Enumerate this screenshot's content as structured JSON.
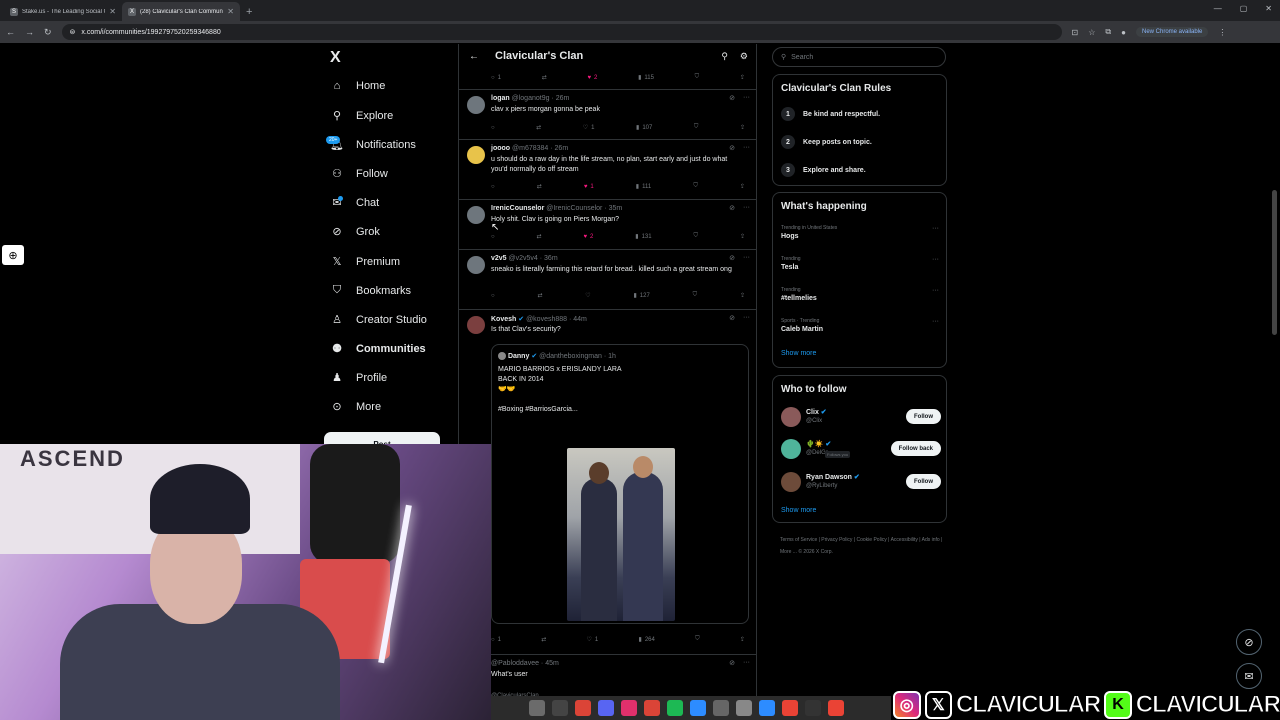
{
  "browser": {
    "tabs": [
      {
        "label": "Stake.us - The Leading Social C",
        "icon": "stake-favicon"
      },
      {
        "label": "(28) Clavicular's Clan Communi",
        "icon": "x-favicon"
      }
    ],
    "url": "x.com/i/communities/1992797520259346880",
    "update_label": "New Chrome available"
  },
  "nav": {
    "logo": "X",
    "items": [
      {
        "label": "Home",
        "icon": "home-icon"
      },
      {
        "label": "Explore",
        "icon": "search-icon"
      },
      {
        "label": "Notifications",
        "icon": "bell-icon"
      },
      {
        "label": "Follow",
        "icon": "follow-icon"
      },
      {
        "label": "Chat",
        "icon": "chat-icon"
      },
      {
        "label": "Grok",
        "icon": "grok-icon"
      },
      {
        "label": "Premium",
        "icon": "x-icon"
      },
      {
        "label": "Bookmarks",
        "icon": "bookmark-icon"
      },
      {
        "label": "Creator Studio",
        "icon": "creator-icon"
      },
      {
        "label": "Communities",
        "icon": "communities-icon"
      },
      {
        "label": "Profile",
        "icon": "profile-icon"
      },
      {
        "label": "More",
        "icon": "more-icon"
      }
    ],
    "notif_badge": "20+",
    "post_label": "Post"
  },
  "feed": {
    "title": "Clavicular's Clan",
    "top_actions": {
      "replies": "1",
      "likes": "2",
      "views": "115"
    },
    "tweets": [
      {
        "name": "logan",
        "handle": "@loganot9g · 26m",
        "text": "clav x piers morgan gonna be peak",
        "replies": "",
        "likes": "1",
        "views": "107",
        "liked": false
      },
      {
        "name": "joooo",
        "handle": "@m678384 · 26m",
        "text": "u should do a raw day in the life stream, no plan, start early and just do what you'd normally do off stream",
        "replies": "",
        "likes": "1",
        "views": "111",
        "liked": true
      },
      {
        "name": "IrenicCounselor",
        "handle": "@IrenicCounselor · 35m",
        "text": "Holy shit. Clav is going on Piers Morgan?",
        "replies": "",
        "likes": "2",
        "views": "131",
        "liked": true
      },
      {
        "name": "v2v5",
        "handle": "@v2v5v4 · 36m",
        "text": "sneako is literally farming this retard for bread.. killed such a great stream ong",
        "replies": "",
        "likes": "",
        "views": "127",
        "liked": false
      },
      {
        "name": "Kovesh",
        "handle": "@kovesh888 · 44m",
        "text": "Is that Clav's security?",
        "replies": "1",
        "likes": "1",
        "views": "264",
        "liked": false
      }
    ],
    "quote": {
      "name": "Danny",
      "handle": "@dantheboxingman · 1h",
      "lines": [
        "MARIO BARRIOS x ERISLANDY LARA",
        "BACK IN 2014",
        "🤝🤝",
        "",
        "#Boxing #BarriosGarcia..."
      ]
    },
    "last_tweet": {
      "handle": "@Pabloddavee · 45m",
      "text": "What's user",
      "sub": "@ClavicularsClan"
    }
  },
  "sidebar": {
    "search_placeholder": "Search",
    "rules_title": "Clavicular's Clan Rules",
    "rules": [
      {
        "num": "1",
        "text": "Be kind and respectful."
      },
      {
        "num": "2",
        "text": "Keep posts on topic."
      },
      {
        "num": "3",
        "text": "Explore and share."
      }
    ],
    "happening_title": "What's happening",
    "trends": [
      {
        "context": "Trending in United States",
        "name": "Hogs"
      },
      {
        "context": "Trending",
        "name": "Tesla"
      },
      {
        "context": "Trending",
        "name": "#tellmelies"
      },
      {
        "context": "Sports · Trending",
        "name": "Caleb Martin"
      }
    ],
    "show_more": "Show more",
    "who_title": "Who to follow",
    "who": [
      {
        "name": "Clix",
        "handle": "@Clix",
        "button": "Follow",
        "follows_you": ""
      },
      {
        "name": "🌵☀️",
        "handle": "@DelGr...",
        "button": "Follow back",
        "follows_you": "Follows you"
      },
      {
        "name": "Ryan Dawson",
        "handle": "@RyLiberty",
        "button": "Follow",
        "follows_you": ""
      }
    ],
    "footer": "Terms of Service | Privacy Policy | Cookie Policy | Accessibility | Ads info | More ... © 2026 X Corp."
  },
  "overlay": {
    "banner_text_1": "CLAVICULAR",
    "banner_text_2": "CLAVICULAR",
    "poster_text": "ASCEND"
  }
}
